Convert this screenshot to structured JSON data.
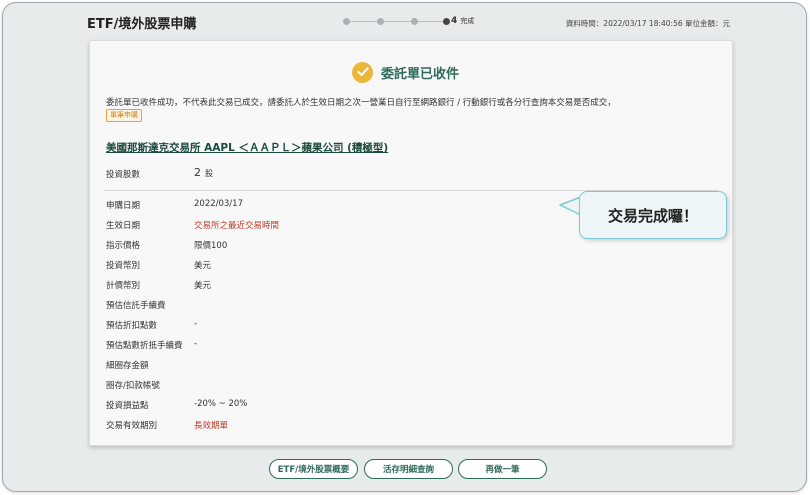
{
  "header": {
    "title": "ETF/境外股票申購",
    "step_number": "4",
    "step_label": "完成",
    "meta": "資料時間：2022/03/17 18:40:56  單位金額：元"
  },
  "status": {
    "title": "委託單已收件",
    "notice": "委託單已收件成功，不代表此交易已成交，請委託人於生效日期之次一營業日自行至網路銀行 / 行動銀行或各分行查詢本交易是否成交，",
    "tag_button": "單筆申購"
  },
  "stock": {
    "link_text": "美國那斯達克交易所 AAPL ＜ＡＡＰＬ＞蘋果公司 (積極型)"
  },
  "shares": {
    "label": "投資股數",
    "value": "2",
    "unit": "股"
  },
  "details": [
    {
      "label": "申購日期",
      "value": "2022/03/17"
    },
    {
      "label": "生效日期",
      "value": "交易所之最近交易時間",
      "red": true
    },
    {
      "label": "指示價格",
      "value": "限價100"
    },
    {
      "label": "投資幣別",
      "value": "美元"
    },
    {
      "label": "計價幣別",
      "value": "美元"
    },
    {
      "label": "預估信託手續費",
      "value": ""
    },
    {
      "label": "預估折扣點數",
      "value": "-"
    },
    {
      "label": "預估點數折抵手續費",
      "value": "-"
    },
    {
      "label": "細圈存金額",
      "value": ""
    },
    {
      "label": "圈存/扣款帳號",
      "value": ""
    },
    {
      "label": "投資損益點",
      "value": "-20% ~ 20%"
    },
    {
      "label": "交易有效期別",
      "value": "長效期單",
      "red": true
    }
  ],
  "callout": {
    "text": "交易完成囉！"
  },
  "actions": {
    "overview": "ETF/境外股票概要",
    "query": "活存明細查詢",
    "again": "再做一筆"
  },
  "colors": {
    "accent": "#2f6a5a",
    "check": "#e9b83a",
    "warning": "#c0392b",
    "callout_border": "#7bc9d6"
  }
}
